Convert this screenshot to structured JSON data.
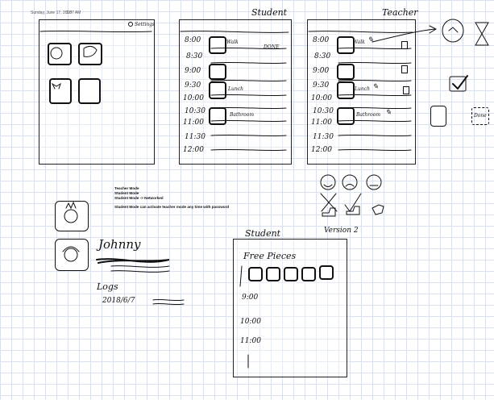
{
  "header": {
    "date": "Sunday, June 17, 2018",
    "time": "1:07 AM"
  },
  "tablet_home": {
    "settings_label": "Settings"
  },
  "student_schedule": {
    "title": "Student",
    "times": [
      "8:00",
      "8:30",
      "9:00",
      "9:30",
      "10:00",
      "10:30",
      "11:00",
      "11:30",
      "12:00"
    ],
    "tasks": [
      "Walk",
      "Lunch",
      "Bathroom"
    ],
    "done_label": "DONE"
  },
  "teacher_schedule": {
    "title": "Teacher",
    "times": [
      "8:00",
      "8:30",
      "9:00",
      "9:30",
      "10:00",
      "10:30",
      "11:00",
      "11:30",
      "12:00"
    ],
    "tasks": [
      "Walk",
      "Lunch",
      "Bathroom"
    ]
  },
  "right_icons": {
    "done_label": "Done"
  },
  "modes_note": {
    "line1": "Teacher Mode",
    "line2": "Student Mode",
    "line3": "Student Mode -> Networked",
    "line4": "Student Mode can activate teacher mode any time with password"
  },
  "feedback": {
    "version_label": "Version 2"
  },
  "profile": {
    "name": "Johnny",
    "logs_label": "Logs",
    "log_date": "2018/6/7"
  },
  "free_pieces_screen": {
    "title": "Student",
    "free_pieces_label": "Free Pieces",
    "times": [
      "9:00",
      "10:00",
      "11:00"
    ]
  }
}
